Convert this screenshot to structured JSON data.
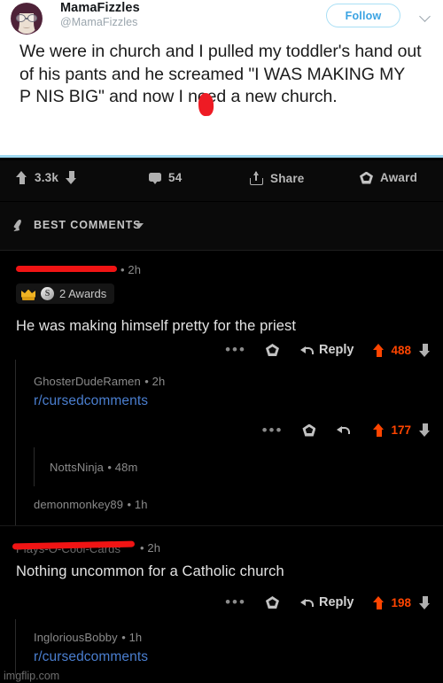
{
  "tweet": {
    "display_name": "MamaFizzles",
    "handle": "@MamaFizzles",
    "follow_label": "Follow",
    "more_icon": "chevron-down-icon",
    "avatar_icon": "avatar",
    "text": "We were in church and I pulled my toddler's hand out of his pants and he screamed \"I WAS MAKING MY P NIS BIG\" and now I need a new church.",
    "censored": true
  },
  "post_actions": {
    "upvote_icon": "upvote-arrow-icon",
    "score": "3.3k",
    "downvote_icon": "downvote-arrow-icon",
    "comments_icon": "comment-bubble-icon",
    "comments_count": "54",
    "share_icon": "share-icon",
    "share_label": "Share",
    "award_icon": "award-pentagon-icon",
    "award_label": "Award"
  },
  "sort": {
    "icon": "rocket-icon",
    "label": "BEST COMMENTS",
    "caret_icon": "caret-down-icon"
  },
  "colors": {
    "upvote_orange": "#ff4500",
    "link_blue": "#4a7ecf",
    "twitter_blue": "#3aa3e3",
    "censor_red": "#f01414",
    "background": "#000000"
  },
  "comments": [
    {
      "id": "c1",
      "author": "",
      "author_redacted": true,
      "time": "2h",
      "awards": {
        "crown_icon": "gold-crown-award-icon",
        "silver_icon": "silver-award-icon",
        "label": "2 Awards"
      },
      "body": "He was making himself pretty for the priest",
      "actions": {
        "dots_icon": "more-options-icon",
        "award_icon": "award-pentagon-icon",
        "reply_icon": "reply-arrow-icon",
        "reply_label": "Reply",
        "upvote_icon": "upvote-arrow-icon",
        "score": "488",
        "downvote_icon": "downvote-arrow-icon"
      }
    },
    {
      "id": "c2",
      "author": "GhosterDudeRamen",
      "time": "2h",
      "body": "",
      "subreddit": "r/cursedcomments",
      "actions": {
        "dots_icon": "more-options-icon",
        "award_icon": "award-pentagon-icon",
        "reply_icon": "reply-arrow-icon",
        "reply_label": "",
        "upvote_icon": "upvote-arrow-icon",
        "score": "177",
        "downvote_icon": "downvote-arrow-icon"
      }
    },
    {
      "id": "c3",
      "author": "NottsNinja",
      "time": "48m"
    },
    {
      "id": "c4",
      "author": "demonmonkey89",
      "time": "1h"
    },
    {
      "id": "c5",
      "author": "",
      "author_redacted": true,
      "time": "2h",
      "body": "Nothing uncommon for a Catholic church",
      "actions": {
        "dots_icon": "more-options-icon",
        "award_icon": "award-pentagon-icon",
        "reply_icon": "reply-arrow-icon",
        "reply_label": "Reply",
        "upvote_icon": "upvote-arrow-icon",
        "score": "198",
        "downvote_icon": "downvote-arrow-icon"
      }
    },
    {
      "id": "c6",
      "author": "IngloriousBobby",
      "time": "1h",
      "subreddit": "r/cursedcomments"
    }
  ],
  "watermark": "imgflip.com"
}
